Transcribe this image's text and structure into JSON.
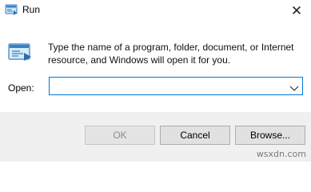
{
  "window": {
    "title": "Run",
    "icon": "run-app-icon",
    "close_glyph": "✕"
  },
  "content": {
    "icon": "run-large-icon",
    "description": "Type the name of a program, folder, document, or Internet resource, and Windows will open it for you."
  },
  "open_field": {
    "label": "Open:",
    "value": "",
    "placeholder": ""
  },
  "buttons": {
    "ok": "OK",
    "cancel": "Cancel",
    "browse": "Browse..."
  },
  "watermark": "wsxdn.com",
  "colors": {
    "accent": "#0078d7",
    "footer_bg": "#f0f0f0",
    "disabled_text": "#8c8c8c"
  }
}
